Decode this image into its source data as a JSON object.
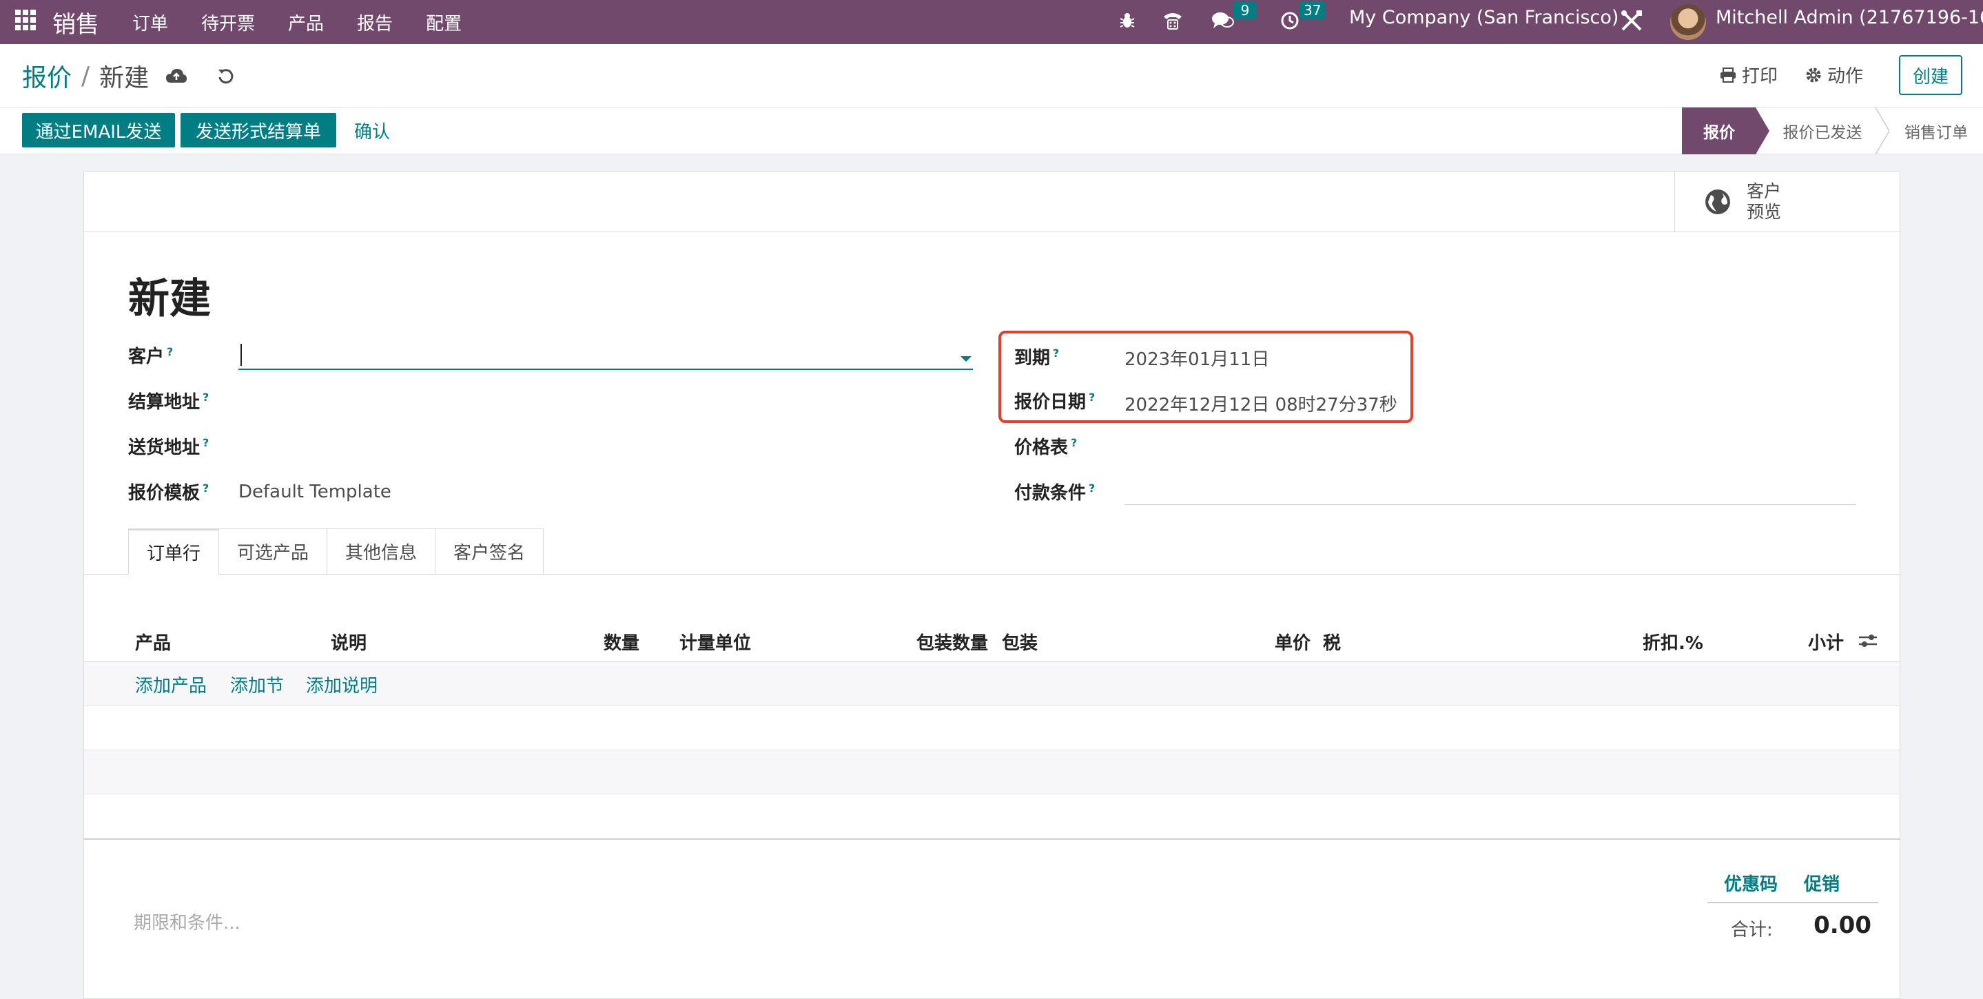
{
  "navbar": {
    "app_name": "销售",
    "menu": [
      "订单",
      "待开票",
      "产品",
      "报告",
      "配置"
    ],
    "messages_count": "9",
    "activities_count": "37",
    "company": "My Company (San Francisco)",
    "user": "Mitchell Admin (21767196-16-0"
  },
  "control_panel": {
    "breadcrumb_parent": "报价",
    "breadcrumb_sep": "/",
    "breadcrumb_current": "新建",
    "print_label": "打印",
    "action_label": "动作",
    "create_label": "创建"
  },
  "statusbar": {
    "send_email": "通过EMAIL发送",
    "send_proforma": "发送形式结算单",
    "confirm": "确认",
    "stages": [
      "报价",
      "报价已发送",
      "销售订单"
    ],
    "active_stage": "报价"
  },
  "smart_button": {
    "line1": "客户",
    "line2": "预览"
  },
  "form": {
    "title": "新建",
    "fields_left": [
      {
        "label": "客户",
        "value": ""
      },
      {
        "label": "结算地址",
        "value": ""
      },
      {
        "label": "送货地址",
        "value": ""
      },
      {
        "label": "报价模板",
        "value": "Default Template"
      }
    ],
    "fields_right": [
      {
        "label": "到期",
        "value": "2023年01月11日"
      },
      {
        "label": "报价日期",
        "value": "2022年12月12日 08时27分37秒"
      },
      {
        "label": "价格表",
        "value": ""
      },
      {
        "label": "付款条件",
        "value": ""
      }
    ],
    "help_mark": "?"
  },
  "tabs": [
    "订单行",
    "可选产品",
    "其他信息",
    "客户签名"
  ],
  "table": {
    "columns": [
      "产品",
      "说明",
      "数量",
      "计量单位",
      "包装数量",
      "包装",
      "单价",
      "税",
      "折扣.%",
      "小计"
    ],
    "add_product": "添加产品",
    "add_section": "添加节",
    "add_note": "添加说明"
  },
  "footer": {
    "terms_placeholder": "期限和条件...",
    "coupon": "优惠码",
    "promotion": "促销",
    "total_label": "合计:",
    "total_value": "0.00"
  },
  "colors": {
    "brand": "#71496c",
    "accent": "#017e84",
    "highlight": "#e53e2a"
  }
}
